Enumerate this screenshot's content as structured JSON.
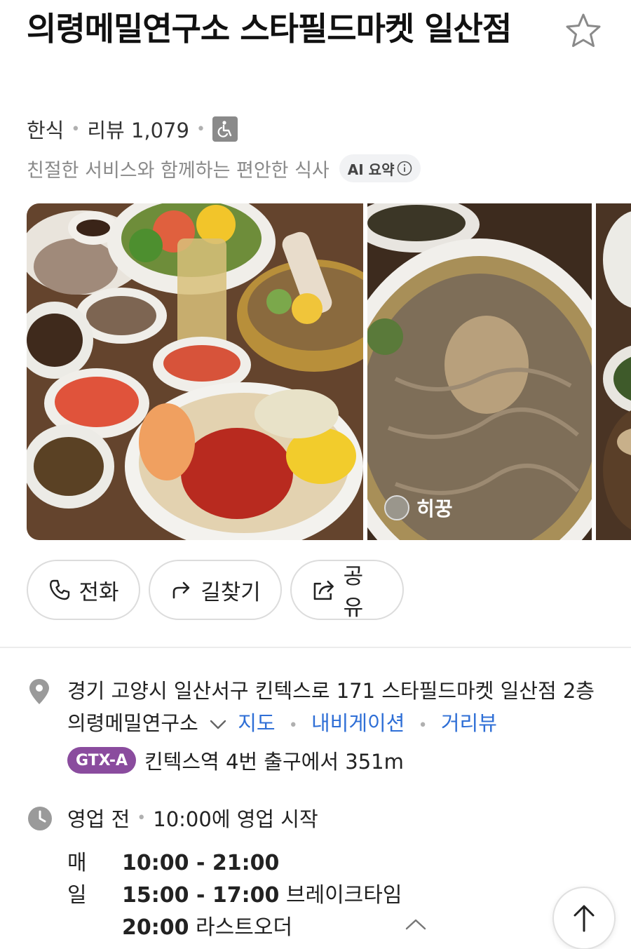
{
  "place": {
    "title": "의령메밀연구소 스타필드마켓 일산점",
    "category": "한식",
    "review_label": "리뷰 1,079",
    "accessibility_icon": "wheelchair-icon",
    "summary": "친절한 서비스와 함께하는 편안한 식사",
    "ai_summary_label": "AI 요약"
  },
  "photos": {
    "items": [
      {
        "desc_icon": "food-photo-1"
      },
      {
        "desc_icon": "food-photo-2",
        "user": "히꿍"
      },
      {
        "desc_icon": "food-photo-3"
      }
    ]
  },
  "actions": {
    "call_label": "전화",
    "directions_label": "길찾기",
    "share_label": "공유"
  },
  "address": {
    "text": "경기 고양시 일산서구 킨텍스로 171 스타필드마켓 일산점 2층 의령메밀연구소",
    "map_link": "지도",
    "navigation_link": "내비게이션",
    "streetview_link": "거리뷰",
    "transit_badge": "GTX-A",
    "transit_text": "킨텍스역 4번 출구에서 351m"
  },
  "hours": {
    "status": "영업 전",
    "status_detail": "10:00에 영업 시작",
    "day": "매일",
    "open_time": "10:00 - 21:00",
    "break_time": "15:00 - 17:00",
    "break_label": "브레이크타임",
    "last_order_time": "20:00",
    "last_order_label": "라스트오더"
  },
  "colors": {
    "link": "#2f6fd6",
    "gtx_badge": "#8a4c9e",
    "muted_text": "#8a8a8a"
  }
}
